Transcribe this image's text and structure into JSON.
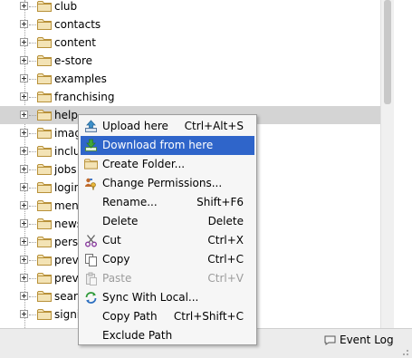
{
  "tree": {
    "items": [
      {
        "label": "club"
      },
      {
        "label": "contacts"
      },
      {
        "label": "content"
      },
      {
        "label": "e-store"
      },
      {
        "label": "examples"
      },
      {
        "label": "franchising"
      },
      {
        "label": "help",
        "selected": true
      },
      {
        "label": "imag"
      },
      {
        "label": "inclu"
      },
      {
        "label": "jobs"
      },
      {
        "label": "login"
      },
      {
        "label": "men"
      },
      {
        "label": "news"
      },
      {
        "label": "perso"
      },
      {
        "label": "previ"
      },
      {
        "label": "previ"
      },
      {
        "label": "searc"
      },
      {
        "label": "signi"
      }
    ]
  },
  "context_menu": {
    "items": [
      {
        "label": "Upload here",
        "shortcut": "Ctrl+Alt+S",
        "icon": "upload-icon"
      },
      {
        "label": "Download from here",
        "shortcut": "",
        "icon": "download-icon",
        "highlighted": true
      },
      {
        "label": "Create Folder...",
        "shortcut": "",
        "icon": "folder-icon"
      },
      {
        "label": "Change Permissions...",
        "shortcut": "",
        "icon": "permissions-icon"
      },
      {
        "label": "Rename...",
        "shortcut": "Shift+F6",
        "icon": ""
      },
      {
        "label": "Delete",
        "shortcut": "Delete",
        "icon": ""
      },
      {
        "label": "Cut",
        "shortcut": "Ctrl+X",
        "icon": "scissors-icon"
      },
      {
        "label": "Copy",
        "shortcut": "Ctrl+C",
        "icon": "copy-icon"
      },
      {
        "label": "Paste",
        "shortcut": "Ctrl+V",
        "icon": "paste-icon",
        "disabled": true
      },
      {
        "label": "Sync With Local...",
        "shortcut": "",
        "icon": "sync-icon"
      },
      {
        "label": "Copy Path",
        "shortcut": "Ctrl+Shift+C",
        "icon": ""
      },
      {
        "label": "Exclude Path",
        "shortcut": "",
        "icon": ""
      }
    ]
  },
  "statusbar": {
    "event_log_label": "Event Log",
    "event_log_icon": "speech-bubble-icon"
  },
  "colors": {
    "selection_bg": "#d4d4d4",
    "menu_highlight": "#2f65ca",
    "folder": "#c9a24a",
    "disabled_text": "#9c9c9c"
  }
}
